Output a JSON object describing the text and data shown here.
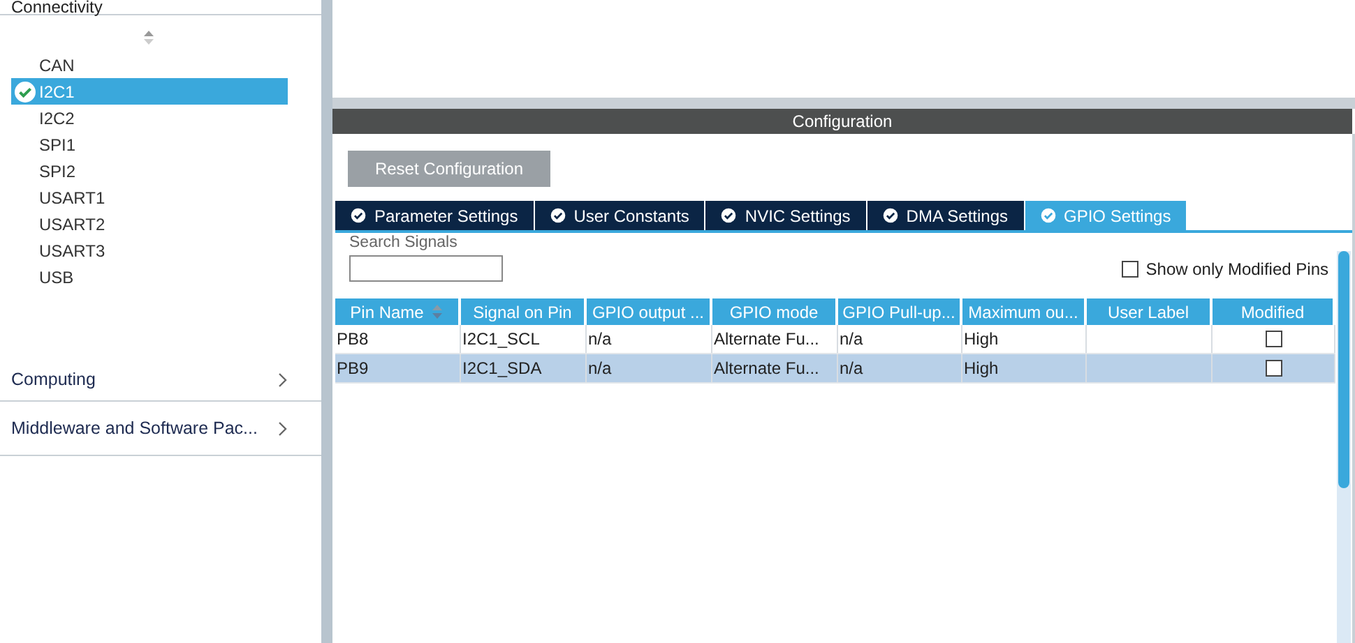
{
  "sidebar": {
    "section_title": "Connectivity",
    "items": [
      {
        "label": "CAN",
        "selected": false,
        "configured": false
      },
      {
        "label": "I2C1",
        "selected": true,
        "configured": true
      },
      {
        "label": "I2C2",
        "selected": false,
        "configured": false
      },
      {
        "label": "SPI1",
        "selected": false,
        "configured": false
      },
      {
        "label": "SPI2",
        "selected": false,
        "configured": false
      },
      {
        "label": "USART1",
        "selected": false,
        "configured": false
      },
      {
        "label": "USART2",
        "selected": false,
        "configured": false
      },
      {
        "label": "USART3",
        "selected": false,
        "configured": false
      },
      {
        "label": "USB",
        "selected": false,
        "configured": false
      }
    ],
    "categories": [
      {
        "label": "Computing"
      },
      {
        "label": "Middleware and Software Pac..."
      }
    ]
  },
  "configuration": {
    "title": "Configuration",
    "reset_button": "Reset Configuration",
    "tabs": [
      {
        "label": "Parameter Settings",
        "selected": false
      },
      {
        "label": "User Constants",
        "selected": false
      },
      {
        "label": "NVIC Settings",
        "selected": false
      },
      {
        "label": "DMA Settings",
        "selected": false
      },
      {
        "label": "GPIO Settings",
        "selected": true
      }
    ],
    "search_label": "Search Signals",
    "show_modified": {
      "label": "Show only Modified Pins",
      "checked": false
    },
    "table": {
      "columns": [
        {
          "label": "Pin Name",
          "sorted": true
        },
        {
          "label": "Signal on Pin",
          "sorted": false
        },
        {
          "label": "GPIO output ...",
          "sorted": false
        },
        {
          "label": "GPIO mode",
          "sorted": false
        },
        {
          "label": "GPIO Pull-up...",
          "sorted": false
        },
        {
          "label": "Maximum ou...",
          "sorted": false
        },
        {
          "label": "User Label",
          "sorted": false
        },
        {
          "label": "Modified",
          "sorted": false
        }
      ],
      "rows": [
        {
          "cells": [
            "PB8",
            "I2C1_SCL",
            "n/a",
            "Alternate Fu...",
            "n/a",
            "High",
            ""
          ],
          "modified": false,
          "selected": false
        },
        {
          "cells": [
            "PB9",
            "I2C1_SDA",
            "n/a",
            "Alternate Fu...",
            "n/a",
            "High",
            ""
          ],
          "modified": false,
          "selected": true
        }
      ]
    }
  }
}
